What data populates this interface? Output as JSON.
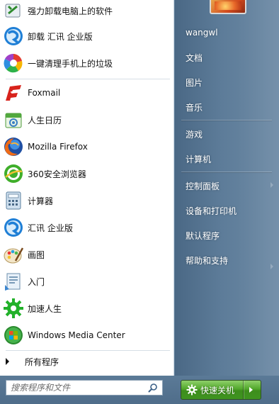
{
  "programs": [
    {
      "label": "强力卸载电脑上的软件",
      "icon": "uninstall-tool-icon"
    },
    {
      "label": "卸载 汇讯 企业版",
      "icon": "huixun-uninstall-icon"
    },
    {
      "label": "一键清理手机上的垃圾",
      "icon": "phone-cleaner-icon"
    },
    {
      "label": "Foxmail",
      "icon": "foxmail-icon"
    },
    {
      "label": "人生日历",
      "icon": "calendar-icon"
    },
    {
      "label": "Mozilla Firefox",
      "icon": "firefox-icon"
    },
    {
      "label": "360安全浏览器",
      "icon": "360-browser-icon"
    },
    {
      "label": "计算器",
      "icon": "calculator-icon"
    },
    {
      "label": "汇讯 企业版",
      "icon": "huixun-icon"
    },
    {
      "label": "画图",
      "icon": "paint-icon"
    },
    {
      "label": "入门",
      "icon": "getting-started-icon"
    },
    {
      "label": "加速人生",
      "icon": "accelerate-gear-icon"
    },
    {
      "label": "Windows Media Center",
      "icon": "media-center-icon"
    }
  ],
  "all_programs_label": "所有程序",
  "search": {
    "placeholder": "搜索程序和文件"
  },
  "user": {
    "name": "wangwl"
  },
  "right_items": {
    "documents": "文档",
    "pictures": "图片",
    "music": "音乐",
    "games": "游戏",
    "computer": "计算机",
    "control_panel": "控制面板",
    "devices_printers": "设备和打印机",
    "default_programs": "默认程序",
    "help_support": "帮助和支持"
  },
  "shutdown": {
    "label": "快速关机"
  },
  "colors": {
    "right_pane": "#5d7c99",
    "shutdown_green": "#52a82c",
    "menu_white": "#ffffff"
  }
}
